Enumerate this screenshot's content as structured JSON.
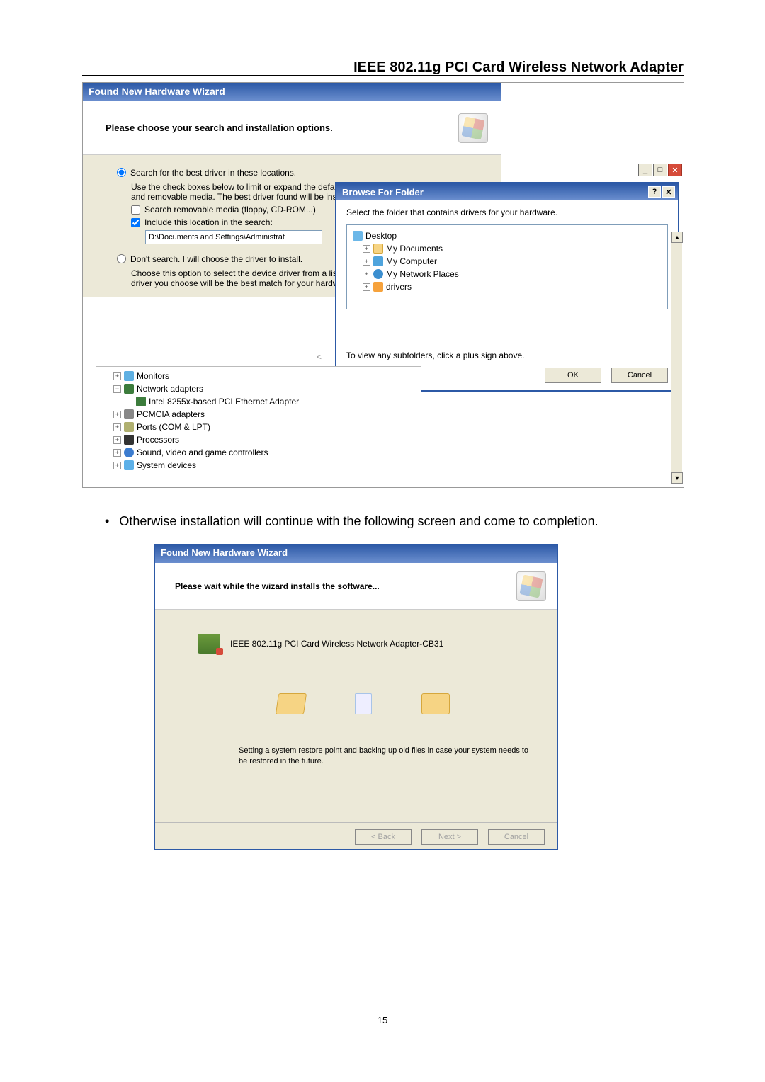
{
  "doc": {
    "header": "IEEE 802.11g PCI Card Wireless Network Adapter",
    "bullet_text": "Otherwise installation will continue with the following screen and come to completion.",
    "page_number": "15"
  },
  "wizard1": {
    "title": "Found New Hardware Wizard",
    "heading": "Please choose your search and installation options.",
    "radio1": "Search for the best driver in these locations.",
    "radio1_help": "Use the check boxes below to limit or expand the default search, which includes local paths and removable media. The best driver found will be installed.",
    "chk_removable": "Search removable media (floppy, CD-ROM...)",
    "chk_include": "Include this location in the search:",
    "path_value": "D:\\Documents and Settings\\Administrat",
    "radio2": "Don't search. I will choose the driver to install.",
    "radio2_help": "Choose this option to select the device driver from a list. Windows does not guarantee that the driver you choose will be the best match for your hardware."
  },
  "browse": {
    "title": "Browse For Folder",
    "instruction": "Select the folder that contains drivers for your hardware.",
    "tree": {
      "desktop": "Desktop",
      "mydocs": "My Documents",
      "mycomp": "My Computer",
      "netplaces": "My Network Places",
      "drivers": "drivers"
    },
    "hint": "To view any subfolders, click a plus sign above.",
    "ok": "OK",
    "cancel": "Cancel"
  },
  "devtree": {
    "monitors": "Monitors",
    "network_adapters": "Network adapters",
    "intel_nic": "Intel 8255x-based PCI Ethernet Adapter",
    "pcmcia": "PCMCIA adapters",
    "ports": "Ports (COM & LPT)",
    "processors": "Processors",
    "sound": "Sound, video and game controllers",
    "system": "System devices"
  },
  "wizard2": {
    "title": "Found New Hardware Wizard",
    "heading": "Please wait while the wizard installs the software...",
    "device": "IEEE 802.11g PCI Card  Wireless Network Adapter-CB31",
    "status": "Setting a system restore point and backing up old files in case your system needs to be restored in the future.",
    "back": "< Back",
    "next": "Next >",
    "cancel": "Cancel"
  }
}
